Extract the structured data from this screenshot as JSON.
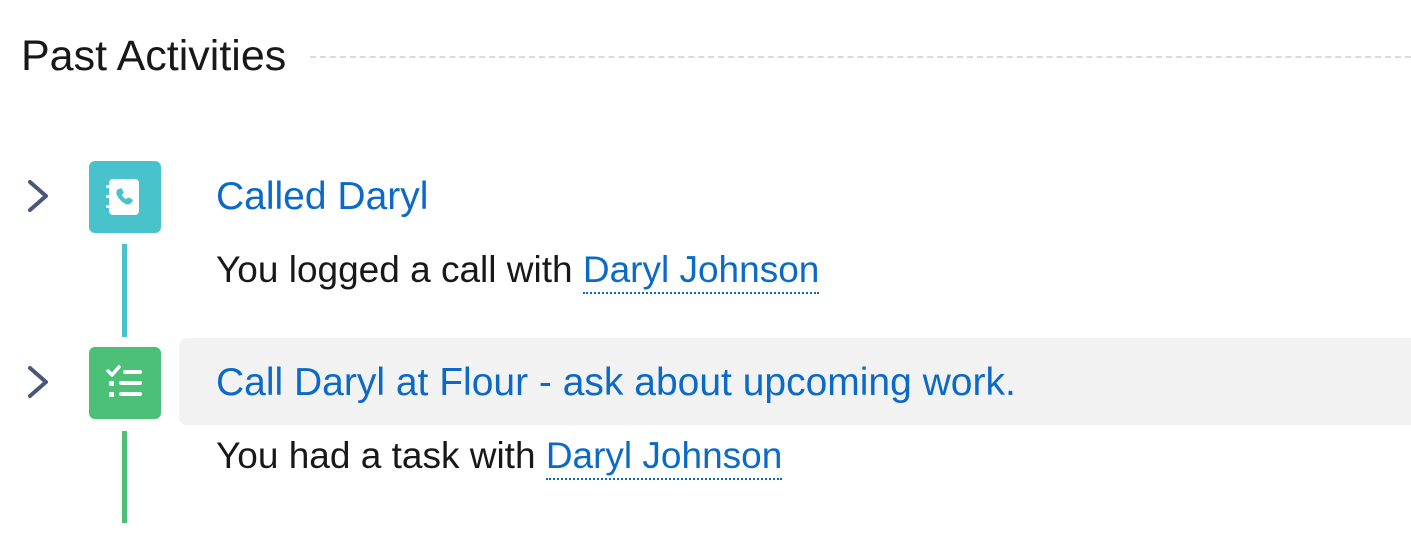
{
  "section": {
    "title": "Past Activities"
  },
  "activities": [
    {
      "type_icon": "call-log-icon",
      "title": "Called Daryl",
      "desc_prefix": "You logged a call with",
      "contact": "Daryl Johnson",
      "color": "#48c3cc"
    },
    {
      "type_icon": "task-list-icon",
      "title": "Call Daryl at Flour - ask about upcoming work.",
      "desc_prefix": "You had a task with",
      "contact": "Daryl Johnson",
      "color": "#4bc076"
    }
  ],
  "colors": {
    "link": "#0b6ac8",
    "text": "#181818",
    "hover_row": "#f3f2f2",
    "chevron": "#4a5878"
  }
}
